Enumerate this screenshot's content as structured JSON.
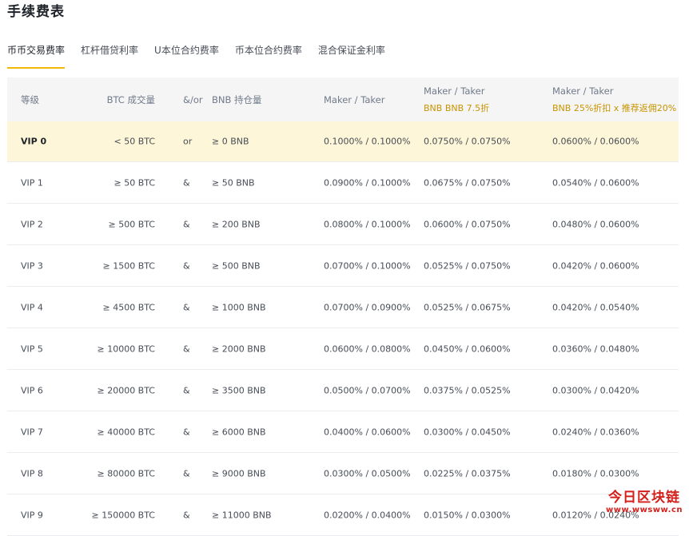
{
  "page": {
    "title": "手续费表"
  },
  "tabs": [
    {
      "label": "币币交易费率",
      "active": true
    },
    {
      "label": "杠杆借贷利率"
    },
    {
      "label": "U本位合约费率"
    },
    {
      "label": "币本位合约费率"
    },
    {
      "label": "混合保证金利率"
    }
  ],
  "table": {
    "headers": {
      "level": "等级",
      "btc_volume": "BTC 成交量",
      "op": "&/or",
      "bnb_holding": "BNB 持仓量",
      "mt": "Maker / Taker",
      "mt_bnb": "Maker / Taker",
      "mt_bnb_sub": "BNB BNB 7.5折",
      "mt_ref": "Maker / Taker",
      "mt_ref_sub": "BNB 25%折扣 x 推荐返佣20%"
    },
    "rows": [
      {
        "level": "VIP 0",
        "btc": "< 50 BTC",
        "op": "or",
        "bnb": "≥ 0 BNB",
        "mt": "0.1000% / 0.1000%",
        "mt_bnb": "0.0750% / 0.0750%",
        "mt_ref": "0.0600% / 0.0600%"
      },
      {
        "level": "VIP 1",
        "btc": "≥ 50 BTC",
        "op": "&",
        "bnb": "≥ 50 BNB",
        "mt": "0.0900% / 0.1000%",
        "mt_bnb": "0.0675% / 0.0750%",
        "mt_ref": "0.0540% / 0.0600%"
      },
      {
        "level": "VIP 2",
        "btc": "≥ 500 BTC",
        "op": "&",
        "bnb": "≥ 200 BNB",
        "mt": "0.0800% / 0.1000%",
        "mt_bnb": "0.0600% / 0.0750%",
        "mt_ref": "0.0480% / 0.0600%"
      },
      {
        "level": "VIP 3",
        "btc": "≥ 1500 BTC",
        "op": "&",
        "bnb": "≥ 500 BNB",
        "mt": "0.0700% / 0.1000%",
        "mt_bnb": "0.0525% / 0.0750%",
        "mt_ref": "0.0420% / 0.0600%"
      },
      {
        "level": "VIP 4",
        "btc": "≥ 4500 BTC",
        "op": "&",
        "bnb": "≥ 1000 BNB",
        "mt": "0.0700% / 0.0900%",
        "mt_bnb": "0.0525% / 0.0675%",
        "mt_ref": "0.0420% / 0.0540%"
      },
      {
        "level": "VIP 5",
        "btc": "≥ 10000 BTC",
        "op": "&",
        "bnb": "≥ 2000 BNB",
        "mt": "0.0600% / 0.0800%",
        "mt_bnb": "0.0450% / 0.0600%",
        "mt_ref": "0.0360% / 0.0480%"
      },
      {
        "level": "VIP 6",
        "btc": "≥ 20000 BTC",
        "op": "&",
        "bnb": "≥ 3500 BNB",
        "mt": "0.0500% / 0.0700%",
        "mt_bnb": "0.0375% / 0.0525%",
        "mt_ref": "0.0300% / 0.0420%"
      },
      {
        "level": "VIP 7",
        "btc": "≥ 40000 BTC",
        "op": "&",
        "bnb": "≥ 6000 BNB",
        "mt": "0.0400% / 0.0600%",
        "mt_bnb": "0.0300% / 0.0450%",
        "mt_ref": "0.0240% / 0.0360%"
      },
      {
        "level": "VIP 8",
        "btc": "≥ 80000 BTC",
        "op": "&",
        "bnb": "≥ 9000 BNB",
        "mt": "0.0300% / 0.0500%",
        "mt_bnb": "0.0225% / 0.0375%",
        "mt_ref": "0.0180% / 0.0300%"
      },
      {
        "level": "VIP 9",
        "btc": "≥ 150000 BTC",
        "op": "&",
        "bnb": "≥ 11000 BNB",
        "mt": "0.0200% / 0.0400%",
        "mt_bnb": "0.0150% / 0.0300%",
        "mt_ref": "0.0120% / 0.0240%"
      }
    ]
  },
  "watermark": {
    "main": "今日区块链",
    "sub": "www.wwsww.cn"
  },
  "colors": {
    "accent": "#f0b90b",
    "highlight_row": "#fef6d8",
    "sub_label": "#c99400",
    "watermark": "#d4201b"
  }
}
